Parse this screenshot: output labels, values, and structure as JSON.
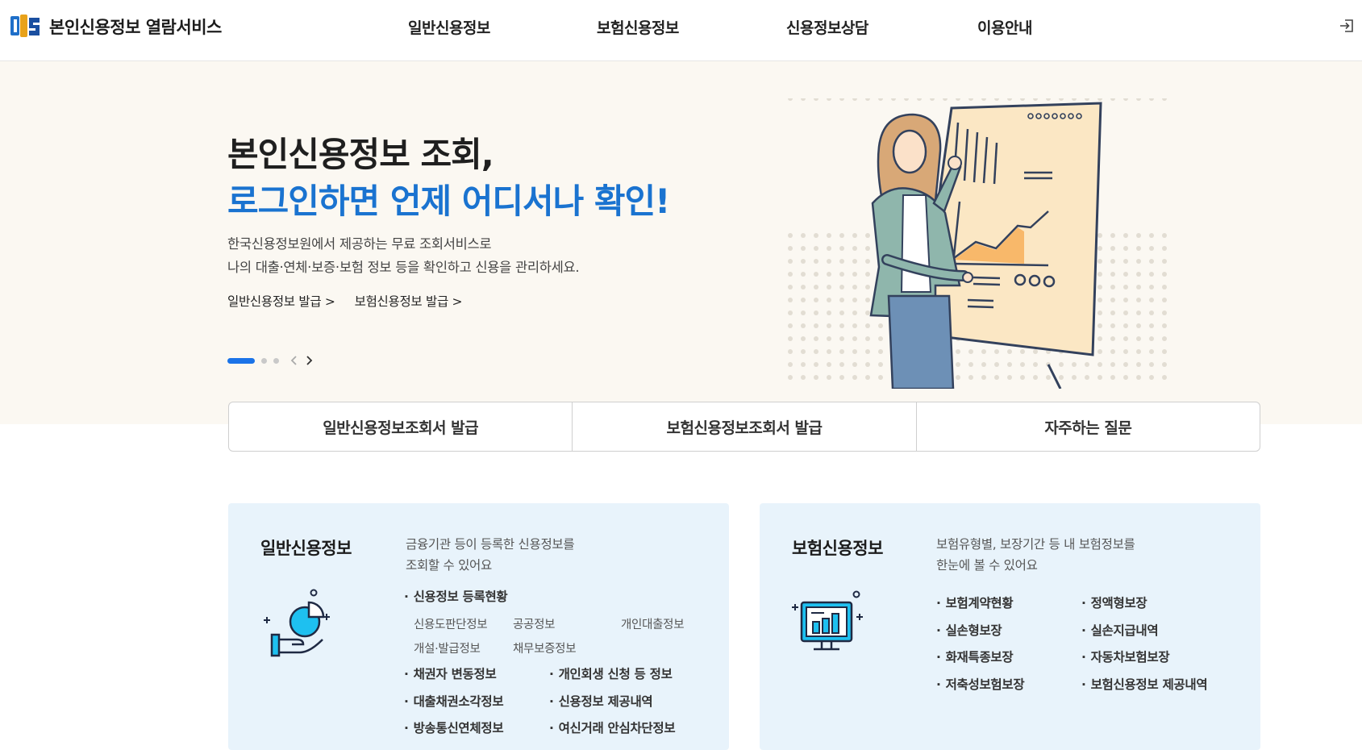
{
  "header": {
    "site_title": "본인신용정보 열람서비스",
    "nav": [
      "일반신용정보",
      "보험신용정보",
      "신용정보상담",
      "이용안내"
    ],
    "login_icon": "login-icon"
  },
  "hero": {
    "title_line1": "본인신용정보 조회,",
    "title_line2": "로그인하면 언제 어디서나 확인!",
    "desc_line1": "한국신용정보원에서 제공하는 무료 조회서비스로",
    "desc_line2": "나의 대출·연체·보증·보험 정보 등을 확인하고 신용을 관리하세요.",
    "link1": "일반신용정보 발급 >",
    "link2": "보험신용정보 발급 >",
    "slides_total": 3,
    "slide_active": 1,
    "accent_color": "#1a73d0",
    "background_color": "#fbf8f2"
  },
  "quick_buttons": [
    "일반신용정보조회서 발급",
    "보험신용정보조회서 발급",
    "자주하는 질문"
  ],
  "card_general": {
    "title": "일반신용정보",
    "desc_line1": "금융기관 등이 등록한 신용정보를",
    "desc_line2": "조회할 수 있어요",
    "icon": "hand-pie-chart-icon",
    "main_item": "신용정보 등록현황",
    "sub_items": [
      "신용도판단정보",
      "공공정보",
      "개인대출정보",
      "개설·발급정보",
      "채무보증정보"
    ],
    "items": [
      "채권자 변동정보",
      "개인회생 신청 등 정보",
      "대출채권소각정보",
      "신용정보 제공내역",
      "방송통신연체정보",
      "여신거래 안심차단정보"
    ]
  },
  "card_insurance": {
    "title": "보험신용정보",
    "desc_line1": "보험유형별, 보장기간 등 내 보험정보를",
    "desc_line2": "한눈에 볼 수 있어요",
    "icon": "monitor-bar-chart-icon",
    "items": [
      "보험계약현황",
      "정액형보장",
      "실손형보장",
      "실손지급내역",
      "화재특종보장",
      "자동차보험보장",
      "저축성보험보장",
      "보험신용정보 제공내역"
    ]
  }
}
